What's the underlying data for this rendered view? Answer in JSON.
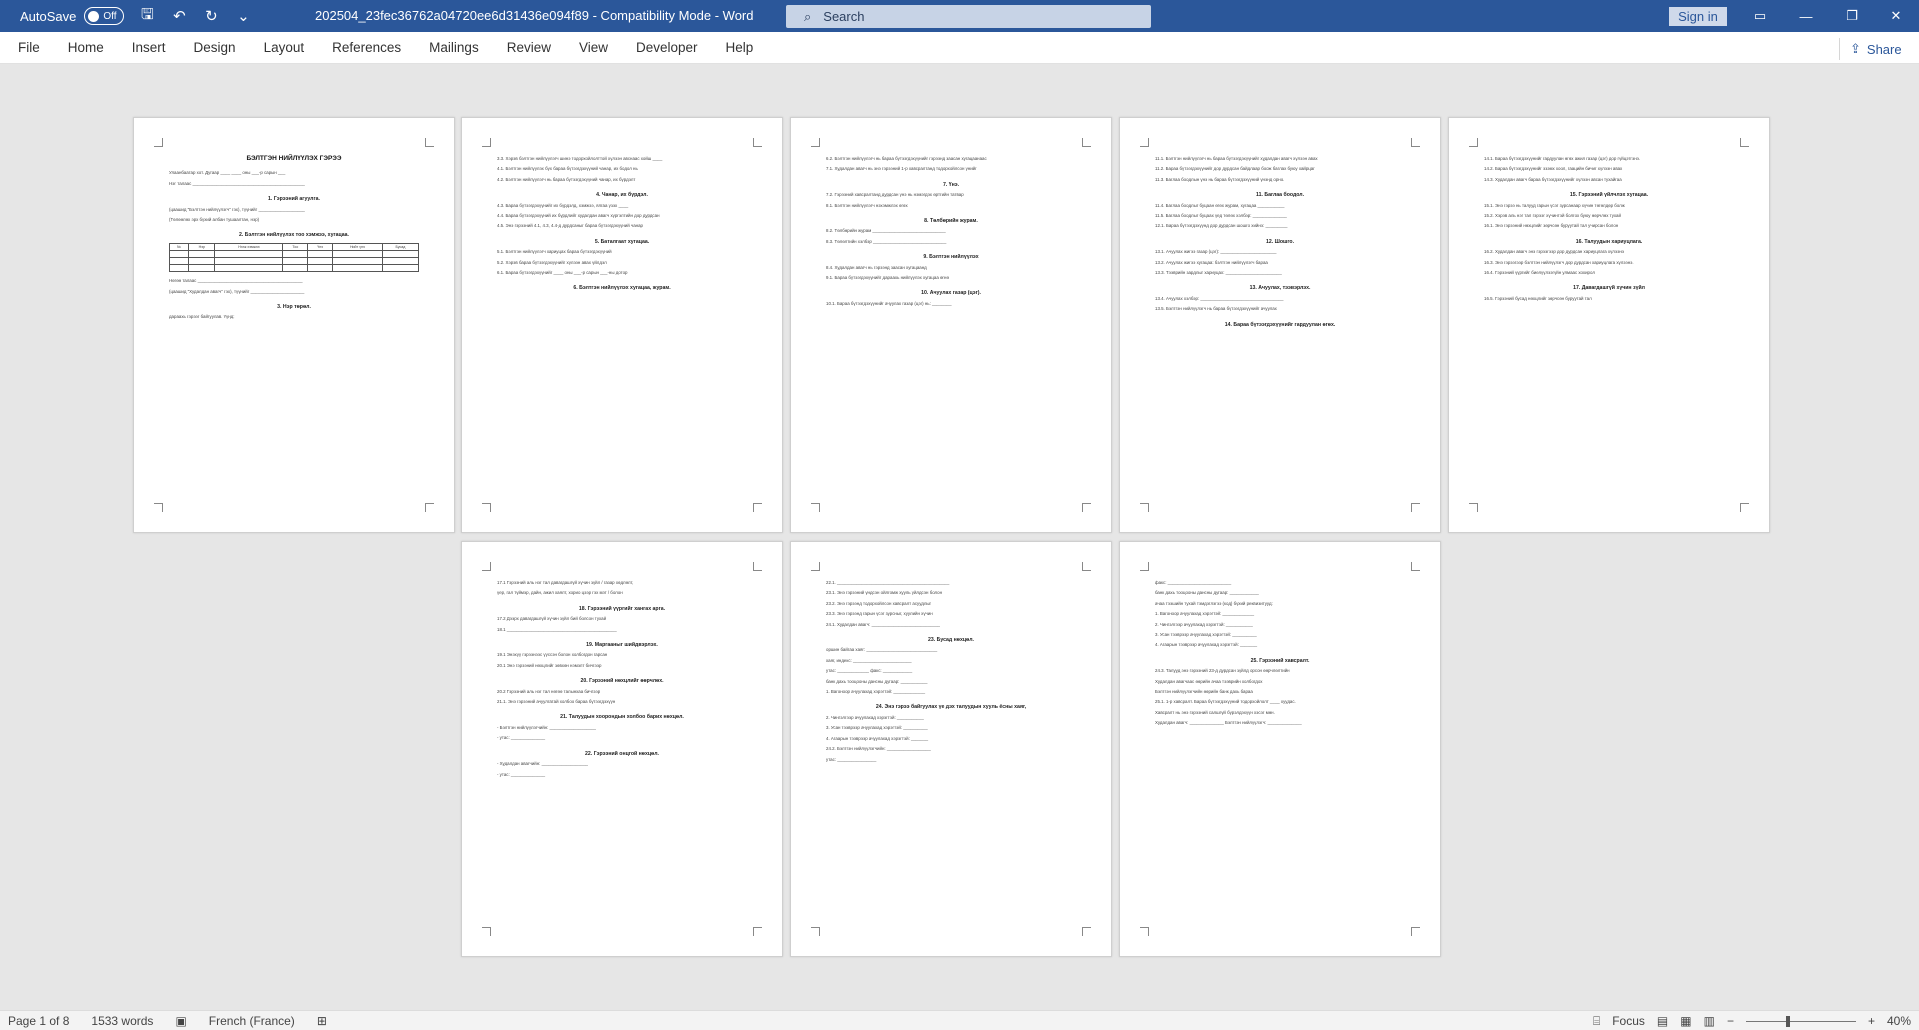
{
  "titlebar": {
    "autosave_label": "AutoSave",
    "autosave_state": "Off",
    "document_title": "202504_23fec36762a04720ee6d31436e094f89  -  Compatibility Mode  -  Word",
    "search_placeholder": "Search",
    "signin_label": "Sign in"
  },
  "ribbon": {
    "tabs": [
      "File",
      "Home",
      "Insert",
      "Design",
      "Layout",
      "References",
      "Mailings",
      "Review",
      "View",
      "Developer",
      "Help"
    ],
    "share_label": "Share"
  },
  "pages": [
    {
      "title": "БЭЛТГЭН НИЙЛҮҮЛЭХ ГЭРЭЭ",
      "lines": [
        "Улаанбаатар хот.          Дугаар ____          ____ оны ___-р сарын ___",
        "Нэг талаас ______________________________________________",
        "(цаашид \"Бэлтгэн нийлүүлэгч\" гэх), түүнийг ___________________",
        "(Төлөөлөх эрх бүхий албан тушаалтан, нэр)",
        "Нөгөө талаас ___________________________________________",
        "(цаашид \"Худалдан авагч\" гэх), түүнийг ______________________",
        "дараахь гэрээг байгуулав. Үүнд:"
      ],
      "heads": [
        "1. Гэрээний агуулга.",
        "2. Бэлтгэн нийлүүлэх тоо хэмжээ, хугацаа.",
        "3. Нэр төрөл."
      ],
      "table_headers": [
        "№",
        "Нэр",
        "Нэгж хэмжээ",
        "Тоо",
        "Үнэ",
        "Нийт үнэ",
        "Бусад"
      ]
    },
    {
      "lines": [
        "3.3. Хэрэв бэлтгэн нийлүүлэгч шинэ тодорхойлолттой хүлээн авснаас хойш ____",
        "4.1. Бэлтгэн нийлүүлэх бүх бараа бүтээгдэхүүний чанар, их бодол нь",
        "4.2. Бэлтгэн нийлүүлэгч нь бараа бүтээгдэхүүний чанар, их бүрдэлт",
        "4.3. Бараа бүтээгдэхүүнийг их бүрдэлд, хэмжээ, ялгаа үзэх ____",
        "4.4. Бараа бүтээгдэхүүний их бүрдлийг худалдан авагч хүргэлтийн дор дурдсан",
        "4.5. Энэ гэрээний 4.1, 4.3, 4.4-д дурдсаныг бараа бүтээгдэхүүний чанар",
        "5.1. Бэлтгэн нийлүүлэгч хариуцах бараа бүтээгдэхүүний",
        "5.2. Хэрэв бараа бүтээгдэхүүнийг хүлээн авах үйлдэл",
        "6.1. Бараа бүтээгдэхүүнийг ____ оны ___-р сарын ___-ны дотор"
      ],
      "heads": [
        "4. Чанар, их бүрдэл.",
        "5. Баталгаат хугацаа.",
        "6. Бэлтгэн нийлүүлэх хугацаа, журам."
      ]
    },
    {
      "lines": [
        "6.2. Бэлтгэн нийлүүлэгч нь бараа бүтээгдэхүүнийг гэрээнд заасан хугацаанаас",
        "7.1. Худалдан авагч нь энэ гэрээний 1-р хавсралтанд тодорхойлсон үнийг",
        "7.2. Гэрээний хавсралтанд дурдсан үнэ нь нэмэгдэх өртгийн татвар",
        "8.1. Бэлтгэн нийлүүлэгч нэхэмжлэх өгөх",
        "8.2. Төлбөрийн журам ______________________________",
        "8.3. Төлөлтийн хэлбэр ______________________________",
        "8.4. Худалдан авагч нь гэрээнд заасан хугацаанд",
        "9.1. Бараа бүтээгдэхүүнийг дараахь нийлүүлэх хугацаа өгнө",
        "10.1. Бараа бүтээгдэхүүнийг ачуулах газар (цэг) нь: ________"
      ],
      "heads": [
        "7. Үнэ.",
        "8. Төлбөрийн журам.",
        "9. Бэлтгэн нийлүүлэх",
        "10. Ачуулах газар (цэг)."
      ]
    },
    {
      "lines": [
        "11.1. Бэлтгэн нийлүүлэгч нь бараа бүтээгдэхүүнийг худалдан авагч хүлээн авах",
        "11.2. Бараа бүтээгдэхүүнийг дор дурдсан байдлаар боож баглах буюу хайрцаг",
        "11.3. Баглаа боодлын үнэ нь бараа бүтээгдэхүүний үнэнд орно.",
        "11.4. Баглаа боодлыг буцаан өгөх журам, хугацаа ___________",
        "11.5. Баглаа боодлыг буцаах үед төлөх хэлбэр: ______________",
        "12.1. Бараа бүтээгдэхүүнд дор дурдсан шошго хийнэ: _________",
        "13.1. Ачуулах жигээ газар (цэг): _______________________",
        "13.2. Ачуулах жигээ хугацаа: бэлтгэн нийлүүлэгч бараа",
        "13.3. Тээврийн зардлыг хариуцах: _______________________",
        "13.4. Ачуулах хэлбэр: __________________________________",
        "13.5. Бэлтгэн нийлүүлэгч нь бараа бүтээгдэхүүнийг ачуулах"
      ],
      "heads": [
        "11. Баглаа боодол.",
        "12. Шошго.",
        "13. Ачуулах, тээвэрлэх.",
        "14. Бараа бүтээгдэхүүнийг гардуулан өгөх."
      ]
    },
    {
      "lines": [
        "14.1. Бараа бүтээгдэхүүнийг гардуулан өгөх ажил газар (цэг) дор гүйцэтгэнэ.",
        "14.2. Бараа бүтээгдэхүүнийг эзэмх хоол, гаацийн бичиг хүлээн авах",
        "14.3. Худалдан авагч бараа бүтээгдэхүүнийг хүлээн авсан тухайгаа",
        "15.1. Энэ гэрээ нь талууд гарын үсэг зурсанаар хүчин төгөлдөр болж",
        "15.2. Хэрэв аль нэг тал гэрээг хүчинтэй болгох буюу өөрчлөх тухай",
        "16.1. Энэ гэрээний нөхцлийг зөрчсөн буруутай тал учирсан болон",
        "16.2. Худалдан авагч энэ гэрээгээр дор дурдсан хариуцлага хүлээнэ",
        "16.3. Энэ гэрээгээр бэлтгэн нийлүүлэгч дор дурдсан хариуцлага хүлээнэ.",
        "16.4. Гэрээний үүргийг биелүүлээгүйн улмаас хохирол",
        "16.5. Гэрээний бусад нөхцлийг зөрчсөн буруутай тал"
      ],
      "heads": [
        "15. Гэрээний үйлчлэх хугацаа.",
        "16. Талуудын хариуцлага.",
        "17. Давагдашгүй хүчин зүйл"
      ]
    },
    {
      "lines": [
        "17.1 Гэрээний аль нэг тал давагдашгүй хүчин зүйл / газар хөдлөлт,",
        "үер, гал түймэр, дайн, ажил хаялт, хорио цээр гэх мэт / болон",
        "17.2 Дээрх давагдашгүй хүчин зүйл бий болсон тухай",
        "18.1 _____________________________________________",
        "19.1 Энэхүү гэрээнээс үүссэн болон холбогдон гарсан",
        "20.1 Энэ гэрээний нөхцлийг зөвхөн нэмэлт бичгээр",
        "20.2 Гэрээний аль нэг тал нөгөө талынхаа бичгээр",
        "21.1. Энэ гэрээний ачуулгатай холбоо бараа бүтээгдэхүүн",
        "- Бэлтгэн нийлүүлэгчийн: ___________________",
        "- утас: ______________",
        "- Худалдан авагчийн: ___________________",
        "- утас: ______________"
      ],
      "heads": [
        "18. Гэрээний үүргийг хангах арга.",
        "19. Маргааныг шийдвэрлэх.",
        "20. Гэрээний нөхцлийг өөрчлөх.",
        "21. Талуудын хоорондын холбоо барих нөхцөл.",
        "22. Гэрээний онцгой нөхцөл."
      ]
    },
    {
      "lines": [
        "22.1. ______________________________________________",
        "23.1. Энэ гэрээний үндсэн ойлгомж хууль үйлдсэн болон",
        "23.2. Энэ гэрээнд тодорхойлсон хавсралт асуудлыг",
        "23.3. Энэ гэрээнд гарын үсэг зурсныг, хуулийн хүчин",
        "24.1. Худалдан авагч: ____________________________",
        "оршин байгаа хаяг: _____________________________",
        "хаяг, индекс: ________________________",
        "утас: _____________ факс: ____________",
        "банк дахь тооцооны дансны дугаар: ___________",
        "1. Вагоноор ачуулахад хэрэгтэй: _____________",
        "2. Чингэлгээр ачуулахад хэрэгтэй: ___________",
        "3. Усан тээврээр ачуулахад хэрэгтэй: __________",
        "4. Агаарын тээврээр ачуулахад хэрэгтэй: _______",
        "24.2. Бэлтгэн нийлүүлэгчийн: __________________",
        "утас: ________________"
      ],
      "heads": [
        "23. Бусад нөхцөл.",
        "24. Энэ гэрээ байгуулах үе дэх талуудын хууль ёсны хаяг,"
      ]
    },
    {
      "lines": [
        "факс: __________________________",
        "банк дахь тооцооны дансны дугаар: ____________",
        "ачаа тээшийн тухай тэмдэглэгээ (код) бүхий реквизитууд:",
        "1. Вагоноор ачуулахад хэрэгтэй: _____________",
        "2. Чингэлгээр ачуулахад хэрэгтэй: ___________",
        "3. Усан тээврээр ачуулахад хэрэгтэй: __________",
        "4. Агаарын тээврээр ачуулахад хэрэгтэй: _______",
        "24.3. Талууд энэ гэрээний 23-д дурдсан зүйлд орсон өөрчлөлтийн",
        "Худалдан авагчаас өөрийн ачаа тээврийн холбогдох",
        "Бэлтгэн нийлүүлэгчийн өөрийн банк дахь бараа",
        "25.1. 1-р хавсралт. Бараа бүтээгдэхүүний тодорхойлолт ____ хуудас.",
        "Хавсралт нь энэ гэрээний салшгүй бүрэлдэхүүн хэсэг мөн.",
        "Худалдан авагч: ______________     Бэлтгэн нийлүүлэгч: ______________"
      ],
      "heads": [
        "25. Гэрээний хавсралт."
      ]
    }
  ],
  "statusbar": {
    "page_info": "Page 1 of 8",
    "word_count": "1533 words",
    "language": "French (France)",
    "focus_label": "Focus",
    "zoom_level": "40%"
  }
}
